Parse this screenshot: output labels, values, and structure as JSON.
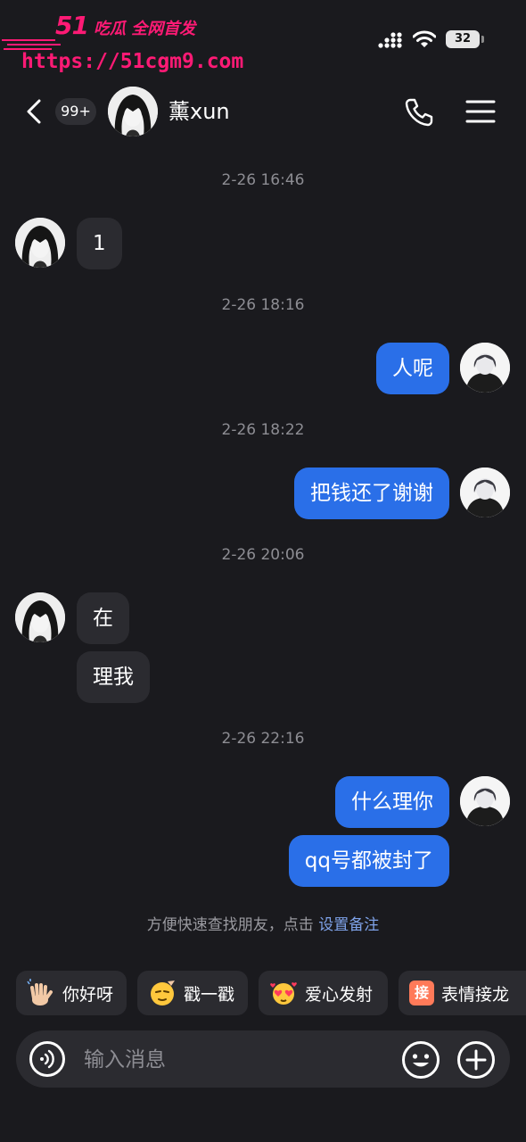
{
  "watermark": {
    "brand": "51",
    "tagline": "吃瓜 全网首发",
    "url": "https://51cgm9.com"
  },
  "status_bar": {
    "battery": "32"
  },
  "header": {
    "badge": "99+",
    "contact_name": "薰xun"
  },
  "chat": {
    "timestamps": [
      "2-26 16:46",
      "2-26 18:16",
      "2-26 18:22",
      "2-26 20:06",
      "2-26 22:16"
    ],
    "messages": [
      {
        "side": "in",
        "text": "1"
      },
      {
        "side": "out",
        "text": "人呢"
      },
      {
        "side": "out",
        "text": "把钱还了谢谢"
      },
      {
        "side": "in",
        "text": "在"
      },
      {
        "side": "in",
        "text": "理我"
      },
      {
        "side": "out",
        "text": "什么理你"
      },
      {
        "side": "out",
        "text": "qq号都被封了"
      }
    ],
    "hint": {
      "text": "方便快速查找朋友，点击",
      "link": "设置备注"
    }
  },
  "quick_replies": [
    {
      "icon": "waving-hand-icon",
      "label": "你好呀"
    },
    {
      "icon": "poke-face-icon",
      "label": "戳一戳"
    },
    {
      "icon": "heart-face-icon",
      "label": "爱心发射"
    },
    {
      "icon": "jie-icon",
      "icon_text": "接",
      "label": "表情接龙"
    }
  ],
  "input": {
    "placeholder": "输入消息"
  },
  "colors": {
    "background": "#1a1a1e",
    "outgoing_bubble": "#2a6fe8",
    "incoming_bubble": "#2b2b30",
    "watermark": "#ff1a75"
  }
}
